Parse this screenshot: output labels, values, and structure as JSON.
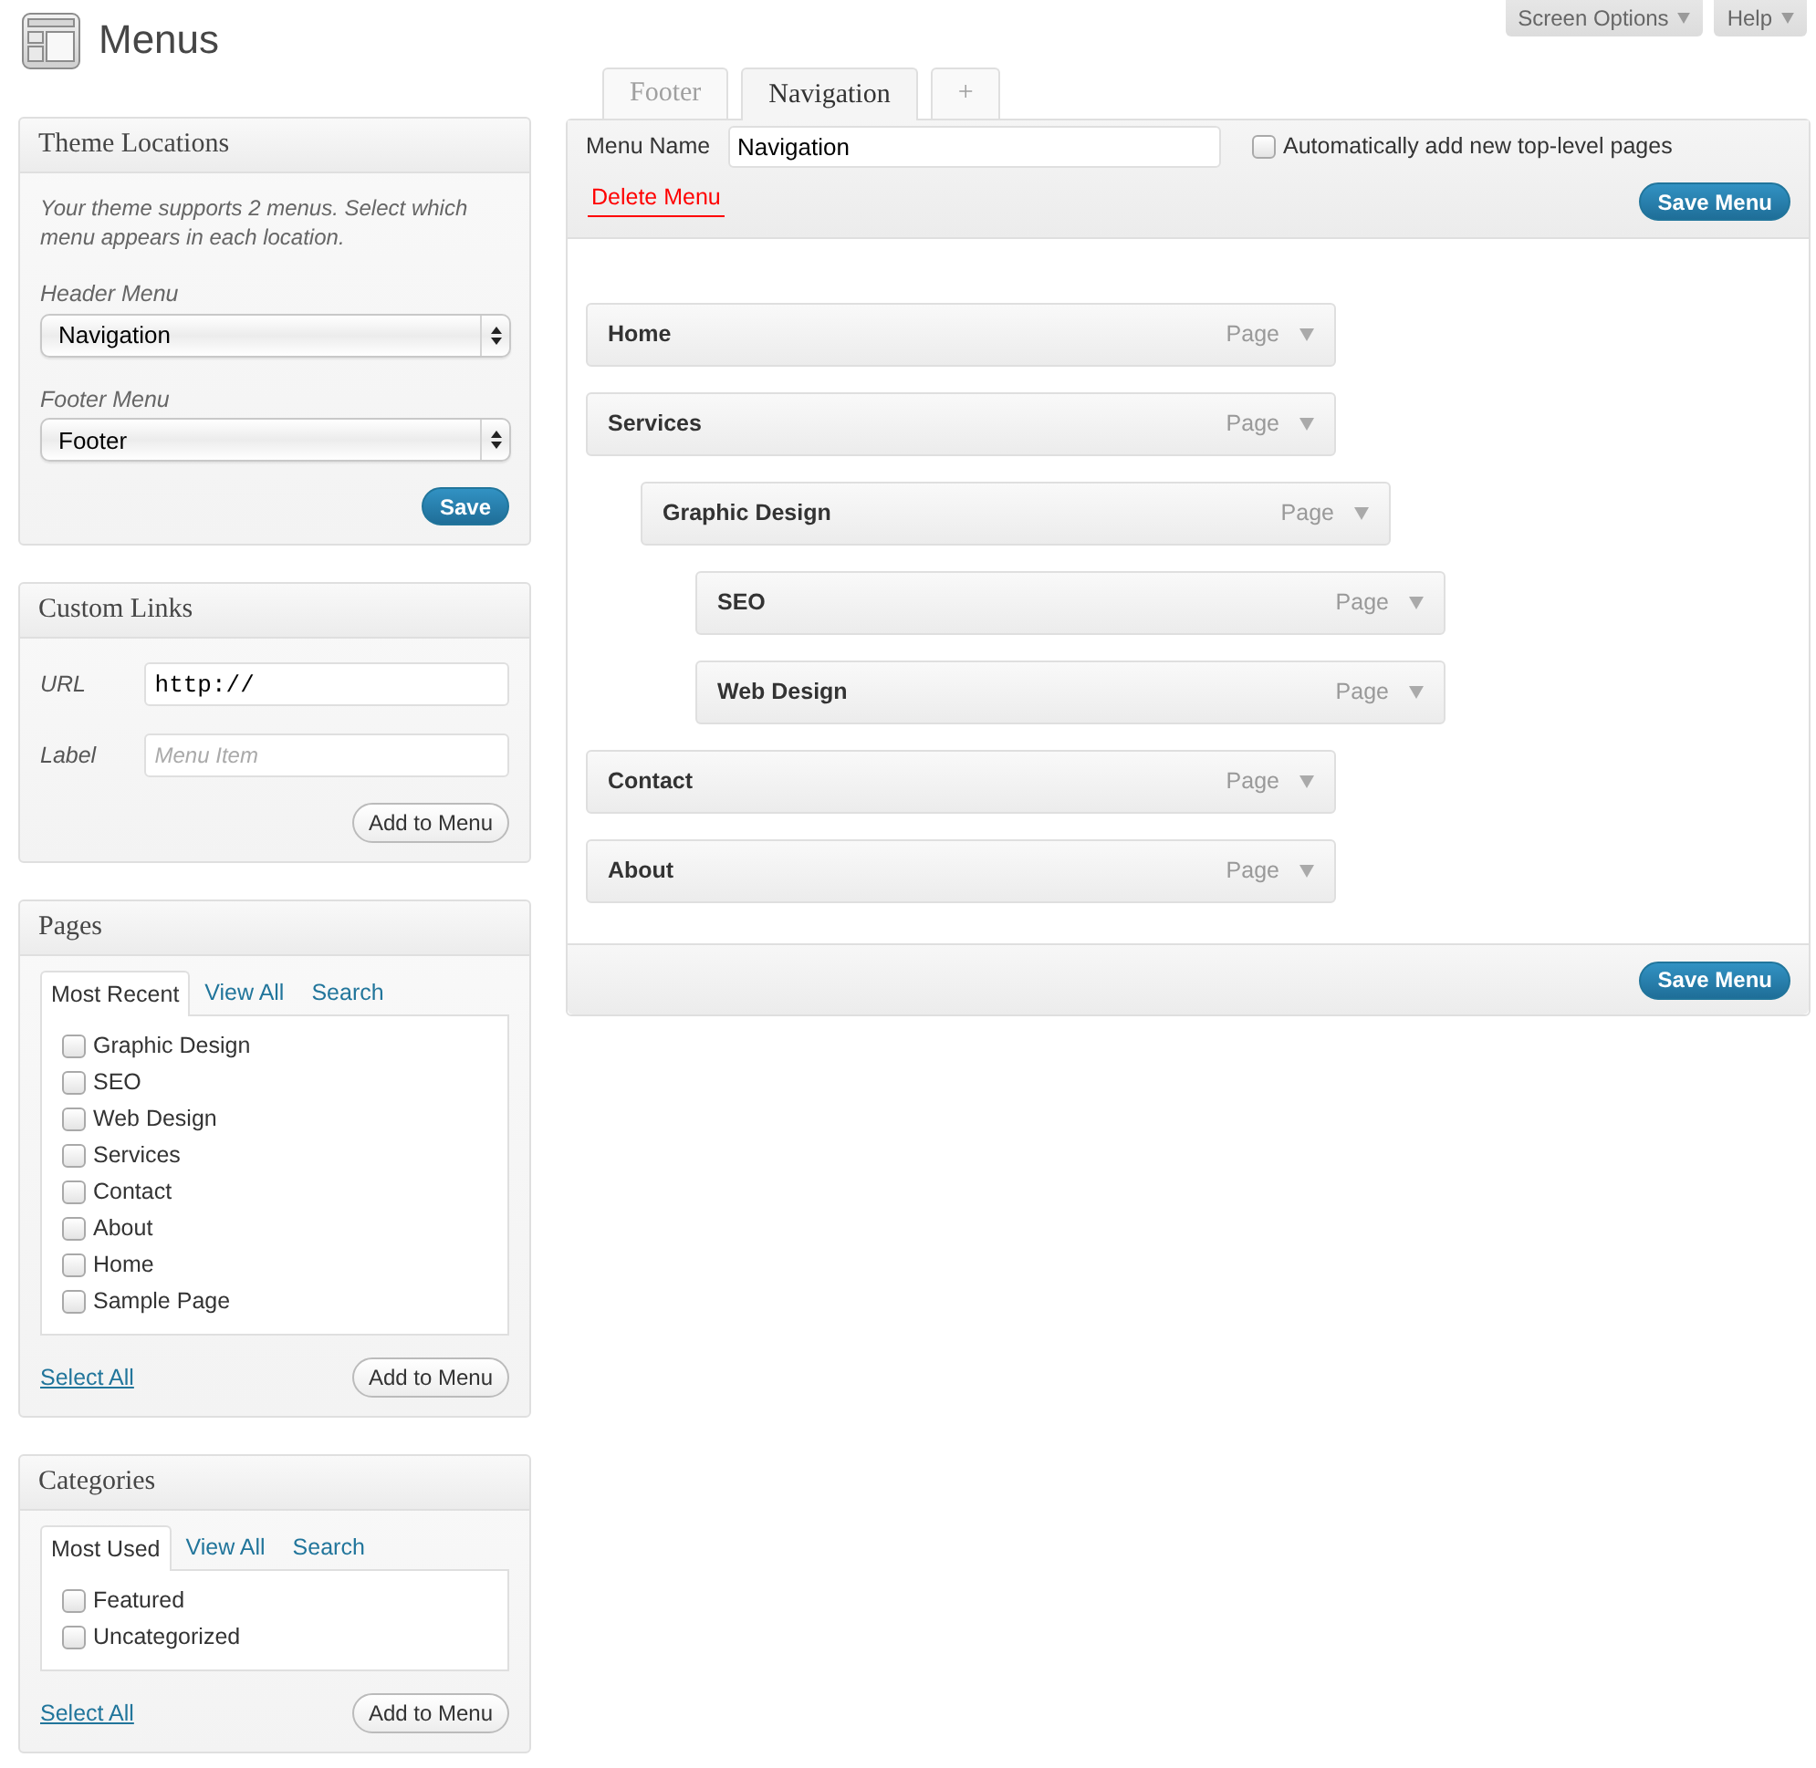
{
  "page": {
    "title": "Menus"
  },
  "top_buttons": [
    {
      "label": "Screen Options"
    },
    {
      "label": "Help"
    }
  ],
  "theme_locations": {
    "title": "Theme Locations",
    "description": "Your theme supports 2 menus. Select which menu appears in each location.",
    "locations": [
      {
        "label": "Header Menu",
        "value": "Navigation"
      },
      {
        "label": "Footer Menu",
        "value": "Footer"
      }
    ],
    "button": "Save"
  },
  "custom_links": {
    "title": "Custom Links",
    "fields": [
      {
        "label": "URL",
        "value": "http://"
      },
      {
        "label": "Label",
        "placeholder": "Menu Item"
      }
    ],
    "button": "Add to Menu"
  },
  "pages": {
    "title": "Pages",
    "tabs": [
      {
        "label": "Most Recent",
        "selected": true
      },
      {
        "label": "View All",
        "selected": false
      },
      {
        "label": "Search",
        "selected": false
      }
    ],
    "items": [
      {
        "label": "Graphic Design",
        "checked": false
      },
      {
        "label": "SEO",
        "checked": false
      },
      {
        "label": "Web Design",
        "checked": false
      },
      {
        "label": "Services",
        "checked": false
      },
      {
        "label": "Contact",
        "checked": false
      },
      {
        "label": "About",
        "checked": false
      },
      {
        "label": "Home",
        "checked": false
      },
      {
        "label": "Sample Page",
        "checked": false
      }
    ],
    "select_all": "Select All",
    "button": "Add to Menu"
  },
  "categories": {
    "title": "Categories",
    "tabs": [
      {
        "label": "Most Used",
        "selected": true
      },
      {
        "label": "View All",
        "selected": false
      },
      {
        "label": "Search",
        "selected": false
      }
    ],
    "items": [
      {
        "label": "Featured",
        "checked": false
      },
      {
        "label": "Uncategorized",
        "checked": false
      }
    ],
    "select_all": "Select All",
    "button": "Add to Menu"
  },
  "menu_tabs": [
    {
      "label": "Footer",
      "selected": false
    },
    {
      "label": "Navigation",
      "selected": true
    },
    {
      "label": "+",
      "selected": false
    }
  ],
  "menu_editor": {
    "name_label": "Menu Name",
    "name_value": "Navigation",
    "auto_add": {
      "label": "Automatically add new top-level pages",
      "checked": false
    },
    "delete_link": "Delete Menu",
    "save_button": "Save Menu",
    "items": [
      {
        "title": "Home",
        "type": "Page"
      },
      {
        "title": "Services",
        "type": "Page",
        "children": [
          {
            "title": "Graphic Design",
            "type": "Page",
            "children": [
              {
                "title": "SEO",
                "type": "Page"
              },
              {
                "title": "Web Design",
                "type": "Page"
              }
            ]
          }
        ]
      },
      {
        "title": "Contact",
        "type": "Page"
      },
      {
        "title": "About",
        "type": "Page"
      }
    ],
    "footer_save_button": "Save Menu"
  }
}
